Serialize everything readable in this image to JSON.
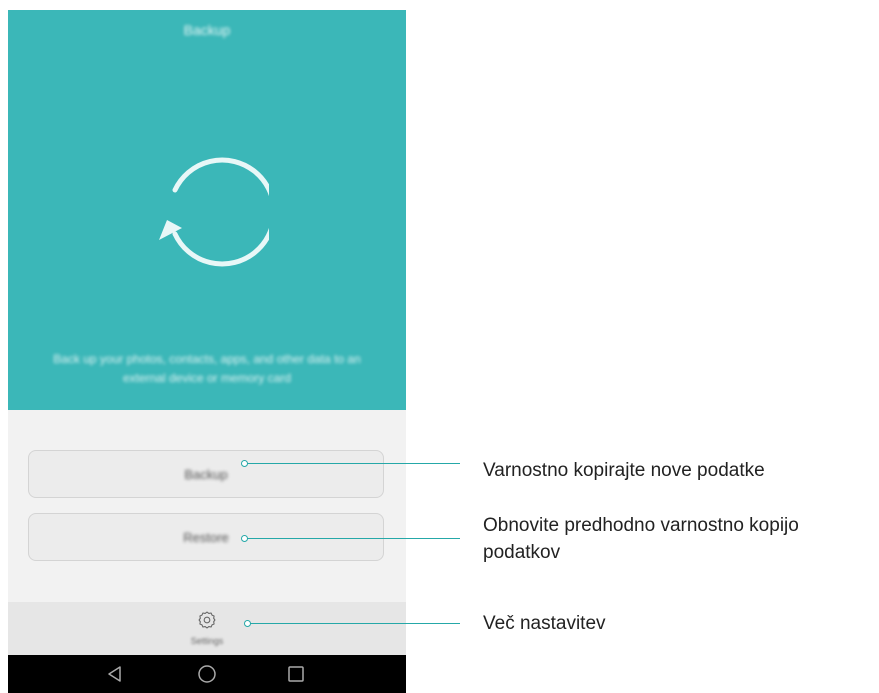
{
  "screen": {
    "title": "Backup",
    "description": "Back up your photos, contacts, apps, and other data to an external device or memory card",
    "buttons": {
      "backup_label": "Backup",
      "restore_label": "Restore"
    },
    "bottom_tab": {
      "settings_label": "Settings",
      "icon": "gear-icon"
    },
    "navigation": {
      "back_icon": "back-triangle-icon",
      "home_icon": "home-circle-icon",
      "recents_icon": "recents-square-icon"
    }
  },
  "callouts": {
    "backup": "Varnostno kopirajte nove podatke",
    "restore": "Obnovite predhodno varnostno kopijo podatkov",
    "settings": "Več nastavitev"
  },
  "colors": {
    "accent": "#3bb7b8",
    "callout_line": "#25a8a8"
  }
}
